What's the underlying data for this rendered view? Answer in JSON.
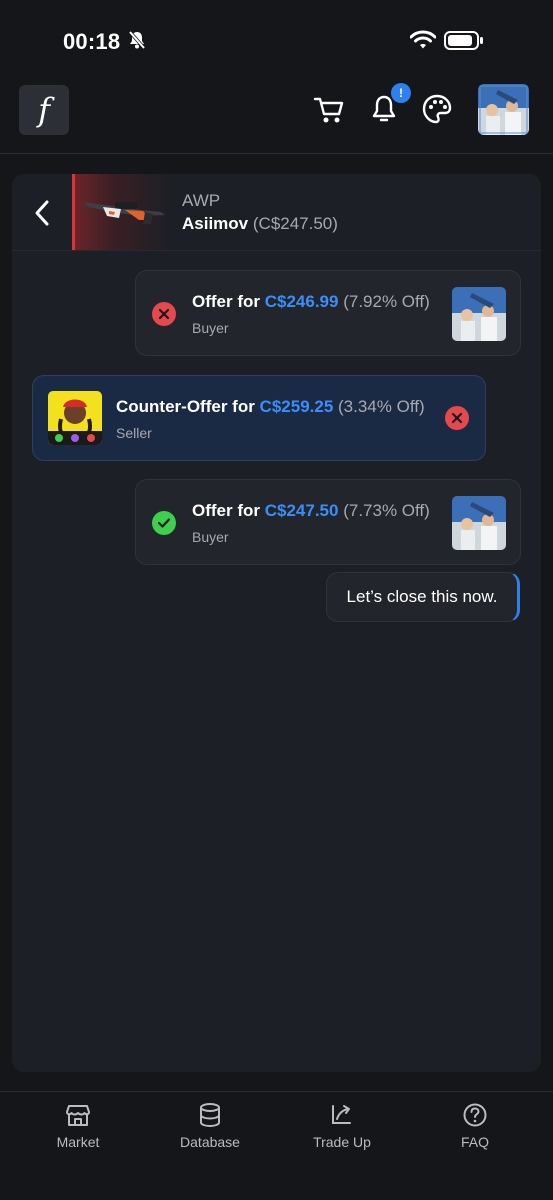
{
  "status_bar": {
    "time": "00:18"
  },
  "header": {
    "logo_letter": "f",
    "notification_badge": "!"
  },
  "item": {
    "name": "AWP",
    "skin": "Asiimov",
    "price": "(C$247.50)"
  },
  "messages": [
    {
      "title": "Offer for ",
      "amount": "C$246.99",
      "discount": "(7.92% Off)",
      "role": "Buyer",
      "status": "declined"
    },
    {
      "title": "Counter-Offer for ",
      "amount": "C$259.25",
      "discount": "(3.34% Off)",
      "role": "Seller",
      "status": "declined"
    },
    {
      "title": "Offer for ",
      "amount": "C$247.50",
      "discount": "(7.73% Off)",
      "role": "Buyer",
      "status": "accepted"
    }
  ],
  "chat_text": "Let’s close this now.",
  "nav": [
    {
      "label": "Market",
      "icon": "store-icon"
    },
    {
      "label": "Database",
      "icon": "database-icon"
    },
    {
      "label": "Trade Up",
      "icon": "trade-up-icon"
    },
    {
      "label": "FAQ",
      "icon": "help-icon"
    }
  ],
  "colors": {
    "accent": "#3c8ef7",
    "declined": "#e5484d",
    "accepted": "#3ecf4c",
    "background": "#141619"
  }
}
